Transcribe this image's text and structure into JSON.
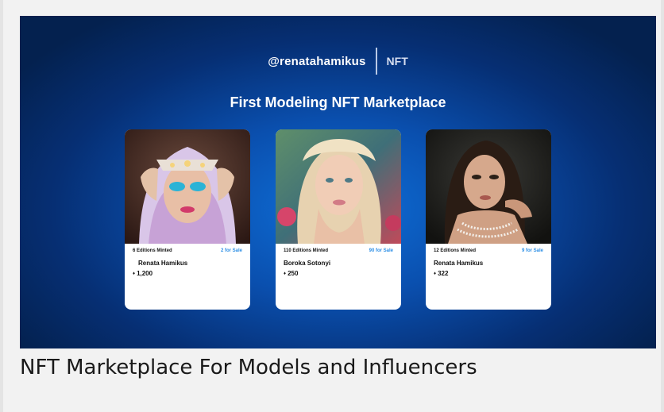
{
  "banner": {
    "handle": "@renatahamikus",
    "tag": "NFT",
    "headline": "First Modeling NFT Marketplace"
  },
  "cards": [
    {
      "editions": "6 Editions Minted",
      "sale": "2 for Sale",
      "name": "Renata Hamikus",
      "currency": "♦",
      "price": "1,200"
    },
    {
      "editions": "110 Editions Minted",
      "sale": "90 for Sale",
      "name": "Boroka Sotonyi",
      "currency": "♦",
      "price": "250"
    },
    {
      "editions": "12 Editions Minted",
      "sale": "9 for Sale",
      "name": "Renata Hamikus",
      "currency": "♦",
      "price": "322"
    }
  ],
  "caption": "NFT Marketplace For Models and Influencers",
  "colors": {
    "banner_center": "#0f6fd8",
    "banner_edge": "#04214f",
    "sale_accent": "#2d8fe6"
  }
}
